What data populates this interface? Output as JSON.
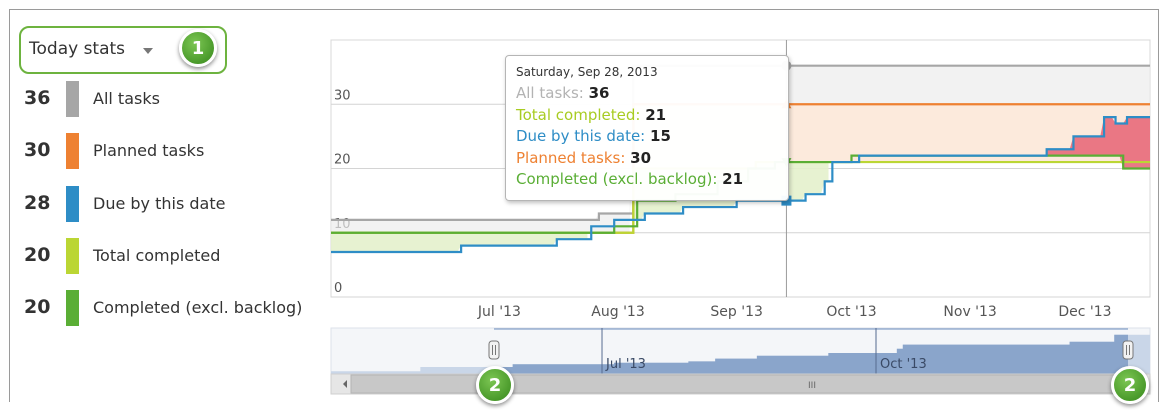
{
  "selector": {
    "label": "Today stats",
    "badge": "1"
  },
  "navigator": {
    "badge_left": "2",
    "badge_right": "2",
    "labels": [
      "Jul '13",
      "Oct '13"
    ],
    "scroll_grip": "III"
  },
  "legend": [
    {
      "count": "36",
      "label": "All tasks",
      "color": "#a6a6a6"
    },
    {
      "count": "30",
      "label": "Planned tasks",
      "color": "#ee8132"
    },
    {
      "count": "28",
      "label": "Due by this date",
      "color": "#2e8dc6"
    },
    {
      "count": "20",
      "label": "Total completed",
      "color": "#bbd634"
    },
    {
      "count": "20",
      "label": "Completed (excl. backlog)",
      "color": "#5aae35"
    }
  ],
  "tooltip": {
    "date": "Saturday, Sep 28, 2013",
    "rows": [
      {
        "label": "All tasks:",
        "value": "36",
        "color": "#b3b3b3"
      },
      {
        "label": "Total completed:",
        "value": "21",
        "color": "#a8cc22"
      },
      {
        "label": "Due by this date:",
        "value": "15",
        "color": "#2e8dc6"
      },
      {
        "label": "Planned tasks:",
        "value": "30",
        "color": "#ee8132"
      },
      {
        "label": "Completed (excl. backlog):",
        "value": "21",
        "color": "#5aae35"
      }
    ]
  },
  "chart_data": {
    "type": "area",
    "x_ticks": [
      "Jul '13",
      "Aug '13",
      "Sep '13",
      "Oct '13",
      "Nov '13",
      "Dec '13"
    ],
    "y_ticks": [
      0,
      10,
      20,
      30
    ],
    "ylim": [
      0,
      40
    ],
    "xlim": [
      "2013-06-01",
      "2014-01-01"
    ],
    "grid": true,
    "crosshair_date": "2013-09-28",
    "series": [
      {
        "name": "All tasks",
        "color": "#a6a6a6",
        "points": [
          [
            "2013-06-01",
            12
          ],
          [
            "2013-07-01",
            12
          ],
          [
            "2013-08-01",
            12
          ],
          [
            "2013-08-10",
            13
          ],
          [
            "2013-08-19",
            20
          ],
          [
            "2013-08-19",
            36
          ],
          [
            "2014-01-01",
            36
          ]
        ]
      },
      {
        "name": "Planned tasks",
        "color": "#ee8132",
        "points": [
          [
            "2013-06-01",
            10
          ],
          [
            "2013-08-19",
            10
          ],
          [
            "2013-08-19",
            30
          ],
          [
            "2014-01-01",
            30
          ]
        ]
      },
      {
        "name": "Due by this date",
        "color": "#2e8dc6",
        "points": [
          [
            "2013-06-01",
            7
          ],
          [
            "2013-07-05",
            8
          ],
          [
            "2013-07-30",
            9
          ],
          [
            "2013-08-08",
            11
          ],
          [
            "2013-08-14",
            12
          ],
          [
            "2013-08-22",
            13
          ],
          [
            "2013-09-01",
            14
          ],
          [
            "2013-09-15",
            15
          ],
          [
            "2013-10-03",
            16
          ],
          [
            "2013-10-08",
            18
          ],
          [
            "2013-10-10",
            21
          ],
          [
            "2013-10-17",
            22
          ],
          [
            "2013-10-30",
            22
          ],
          [
            "2013-11-08",
            22
          ],
          [
            "2013-11-30",
            22
          ],
          [
            "2013-12-05",
            23
          ],
          [
            "2013-12-12",
            25
          ],
          [
            "2013-12-20",
            28
          ],
          [
            "2013-12-23",
            27
          ],
          [
            "2013-12-26",
            28
          ],
          [
            "2014-01-01",
            28
          ]
        ]
      },
      {
        "name": "Total completed",
        "color": "#bbd634",
        "points": [
          [
            "2013-06-01",
            10
          ],
          [
            "2013-07-15",
            10
          ],
          [
            "2013-08-09",
            10
          ],
          [
            "2013-08-19",
            11
          ],
          [
            "2013-08-19",
            20
          ],
          [
            "2013-09-05",
            20
          ],
          [
            "2013-09-20",
            21
          ],
          [
            "2013-10-10",
            21
          ],
          [
            "2014-01-01",
            21
          ]
        ]
      },
      {
        "name": "Completed (excl. backlog)",
        "color": "#5aae35",
        "points": [
          [
            "2013-06-01",
            10
          ],
          [
            "2013-08-09",
            10
          ],
          [
            "2013-08-14",
            11
          ],
          [
            "2013-08-19",
            11
          ],
          [
            "2013-08-20",
            15
          ],
          [
            "2013-08-30",
            16
          ],
          [
            "2013-09-10",
            18
          ],
          [
            "2013-09-18",
            20
          ],
          [
            "2013-09-25",
            21
          ],
          [
            "2013-10-15",
            22
          ],
          [
            "2013-12-10",
            22
          ],
          [
            "2013-12-25",
            20
          ],
          [
            "2014-01-01",
            20
          ]
        ]
      }
    ]
  }
}
